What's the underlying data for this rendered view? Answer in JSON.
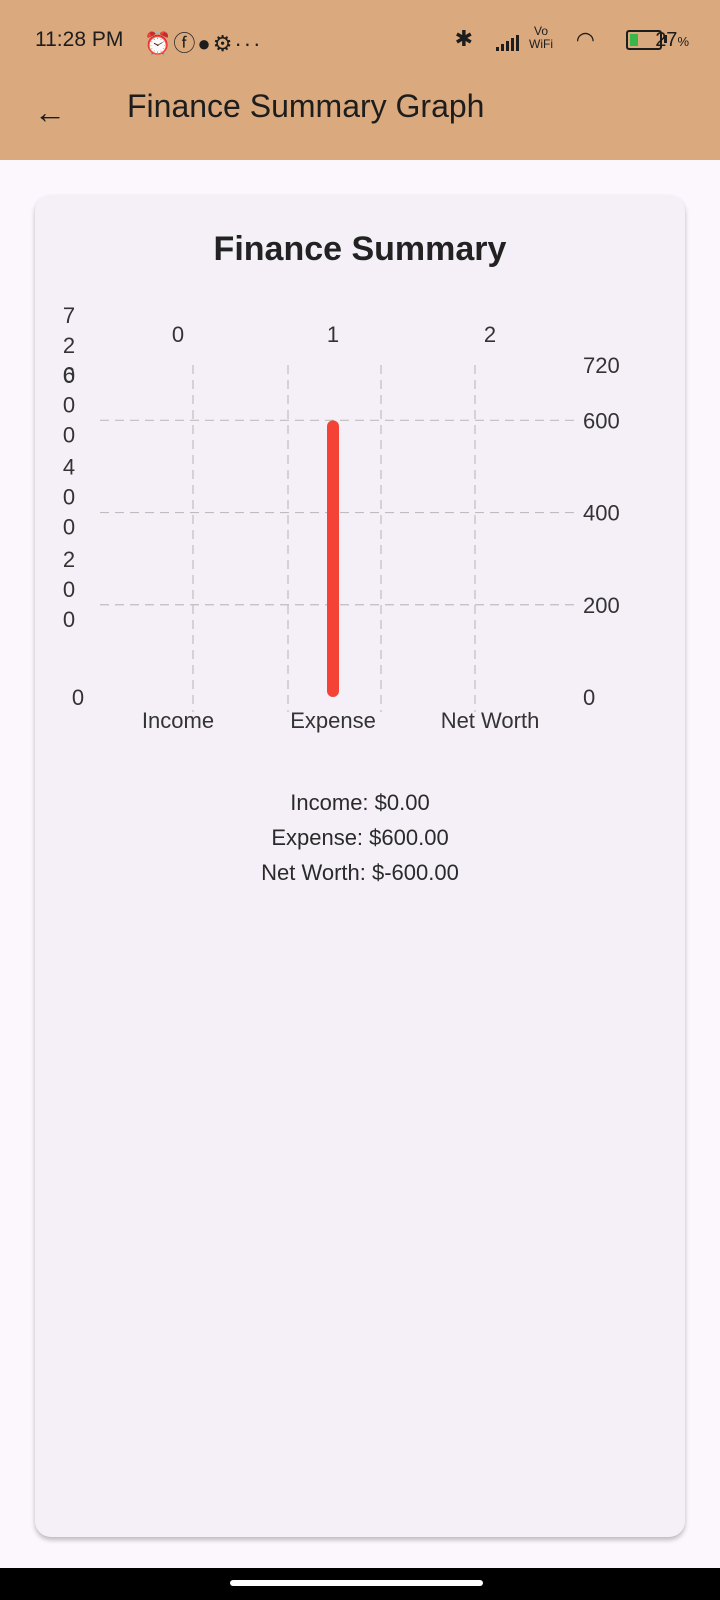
{
  "status_bar": {
    "time": "11:28 PM",
    "notification_icons": [
      "alarm-icon",
      "facebook-icon",
      "chat-icon",
      "settings-icon",
      "more-icon"
    ],
    "vo_wifi": "Vo WiFi",
    "battery_percent": "27",
    "battery_level": 0.27,
    "battery_color": "#39b54a"
  },
  "app_bar": {
    "title": "Finance Summary Graph",
    "background": "#daa97e"
  },
  "chart_data": {
    "type": "bar",
    "title": "Finance Summary",
    "categories": [
      "Income",
      "Expense",
      "Net Worth"
    ],
    "top_ticks": [
      "0",
      "1",
      "2"
    ],
    "values": [
      0,
      600,
      -600
    ],
    "bar_color": "#f44336",
    "ylim": [
      0,
      720
    ],
    "y_ticks_right": [
      "0",
      "200",
      "400",
      "600",
      "720"
    ],
    "y_ticks_left_vertical": [
      "0",
      "200",
      "400",
      "600",
      "720"
    ],
    "grid": true
  },
  "summary": {
    "income": "Income: $0.00",
    "expense": "Expense: $600.00",
    "net_worth": "Net Worth: $-600.00"
  }
}
